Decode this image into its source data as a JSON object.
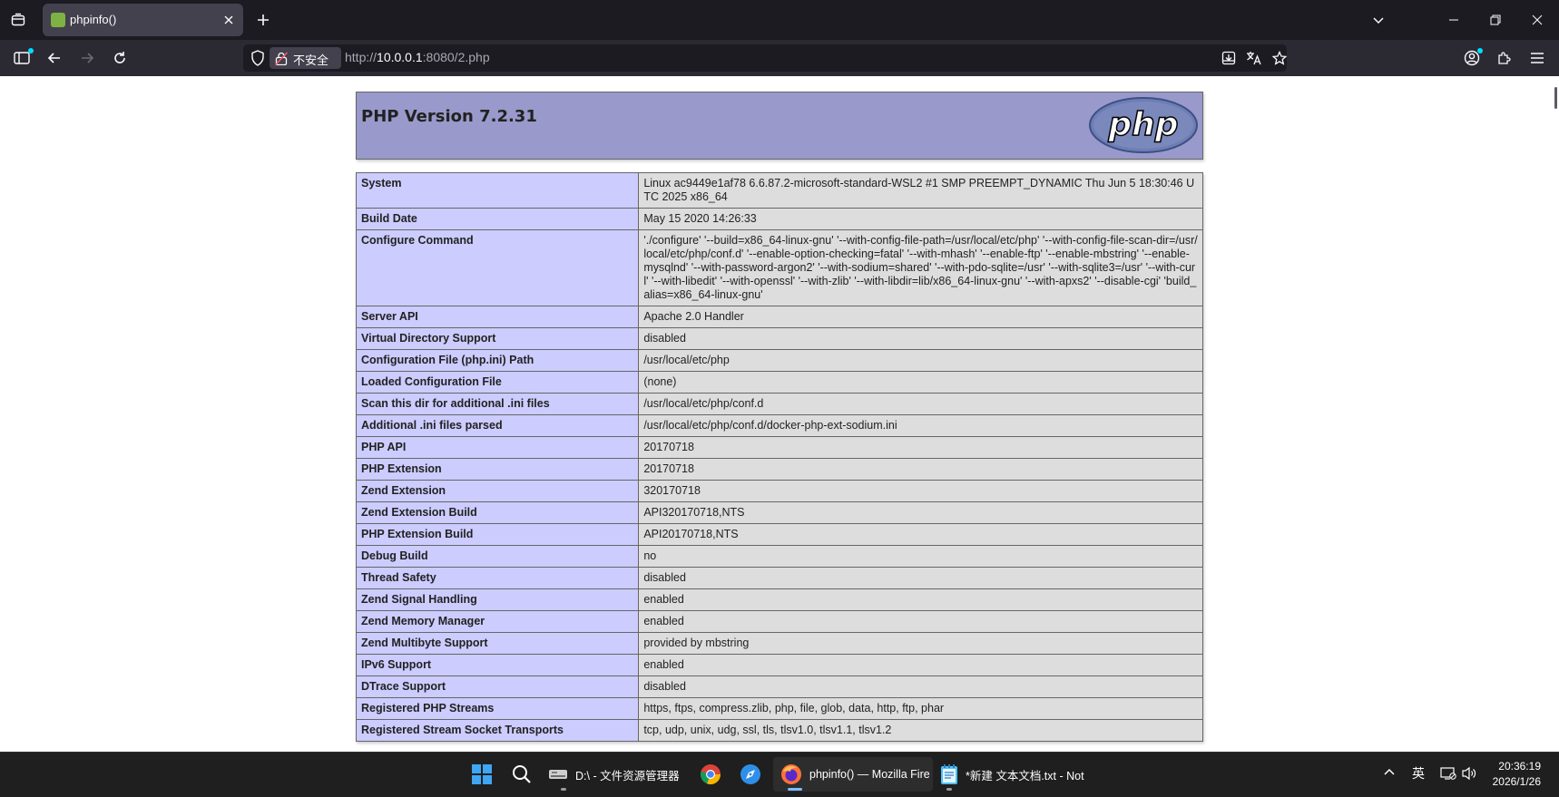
{
  "browser": {
    "tab_title": "phpinfo()",
    "insecure_label": "不安全",
    "url_scheme": "http://",
    "url_host": "10.0.0.1",
    "url_path": ":8080/2.php"
  },
  "page": {
    "php_version_title": "PHP Version 7.2.31",
    "logo_text": "php",
    "rows": [
      {
        "key": "System",
        "value": "Linux ac9449e1af78 6.6.87.2-microsoft-standard-WSL2 #1 SMP PREEMPT_DYNAMIC Thu Jun 5 18:30:46 UTC 2025 x86_64"
      },
      {
        "key": "Build Date",
        "value": "May 15 2020 14:26:33"
      },
      {
        "key": "Configure Command",
        "value": "'./configure' '--build=x86_64-linux-gnu' '--with-config-file-path=/usr/local/etc/php' '--with-config-file-scan-dir=/usr/local/etc/php/conf.d' '--enable-option-checking=fatal' '--with-mhash' '--enable-ftp' '--enable-mbstring' '--enable-mysqlnd' '--with-password-argon2' '--with-sodium=shared' '--with-pdo-sqlite=/usr' '--with-sqlite3=/usr' '--with-curl' '--with-libedit' '--with-openssl' '--with-zlib' '--with-libdir=lib/x86_64-linux-gnu' '--with-apxs2' '--disable-cgi' 'build_alias=x86_64-linux-gnu'"
      },
      {
        "key": "Server API",
        "value": "Apache 2.0 Handler"
      },
      {
        "key": "Virtual Directory Support",
        "value": "disabled"
      },
      {
        "key": "Configuration File (php.ini) Path",
        "value": "/usr/local/etc/php"
      },
      {
        "key": "Loaded Configuration File",
        "value": "(none)"
      },
      {
        "key": "Scan this dir for additional .ini files",
        "value": "/usr/local/etc/php/conf.d"
      },
      {
        "key": "Additional .ini files parsed",
        "value": "/usr/local/etc/php/conf.d/docker-php-ext-sodium.ini"
      },
      {
        "key": "PHP API",
        "value": "20170718"
      },
      {
        "key": "PHP Extension",
        "value": "20170718"
      },
      {
        "key": "Zend Extension",
        "value": "320170718"
      },
      {
        "key": "Zend Extension Build",
        "value": "API320170718,NTS"
      },
      {
        "key": "PHP Extension Build",
        "value": "API20170718,NTS"
      },
      {
        "key": "Debug Build",
        "value": "no"
      },
      {
        "key": "Thread Safety",
        "value": "disabled"
      },
      {
        "key": "Zend Signal Handling",
        "value": "enabled"
      },
      {
        "key": "Zend Memory Manager",
        "value": "enabled"
      },
      {
        "key": "Zend Multibyte Support",
        "value": "provided by mbstring"
      },
      {
        "key": "IPv6 Support",
        "value": "enabled"
      },
      {
        "key": "DTrace Support",
        "value": "disabled"
      },
      {
        "key": "Registered PHP Streams",
        "value": "https, ftps, compress.zlib, php, file, glob, data, http, ftp, phar"
      },
      {
        "key": "Registered Stream Socket Transports",
        "value": "tcp, udp, unix, udg, ssl, tls, tlsv1.0, tlsv1.1, tlsv1.2"
      }
    ]
  },
  "taskbar": {
    "explorer_label": "D:\\ - 文件资源管理器",
    "firefox_label": "phpinfo() — Mozilla Fire",
    "notepad_label": "*新建 文本文档.txt - Not",
    "ime_label": "英",
    "time": "20:36:19",
    "date": "2026/1/26"
  },
  "colors": {
    "php_header_bg": "#9999cc",
    "key_cell_bg": "#ccccff",
    "value_cell_bg": "#dddddd",
    "browser_chrome": "#2b2a33"
  }
}
